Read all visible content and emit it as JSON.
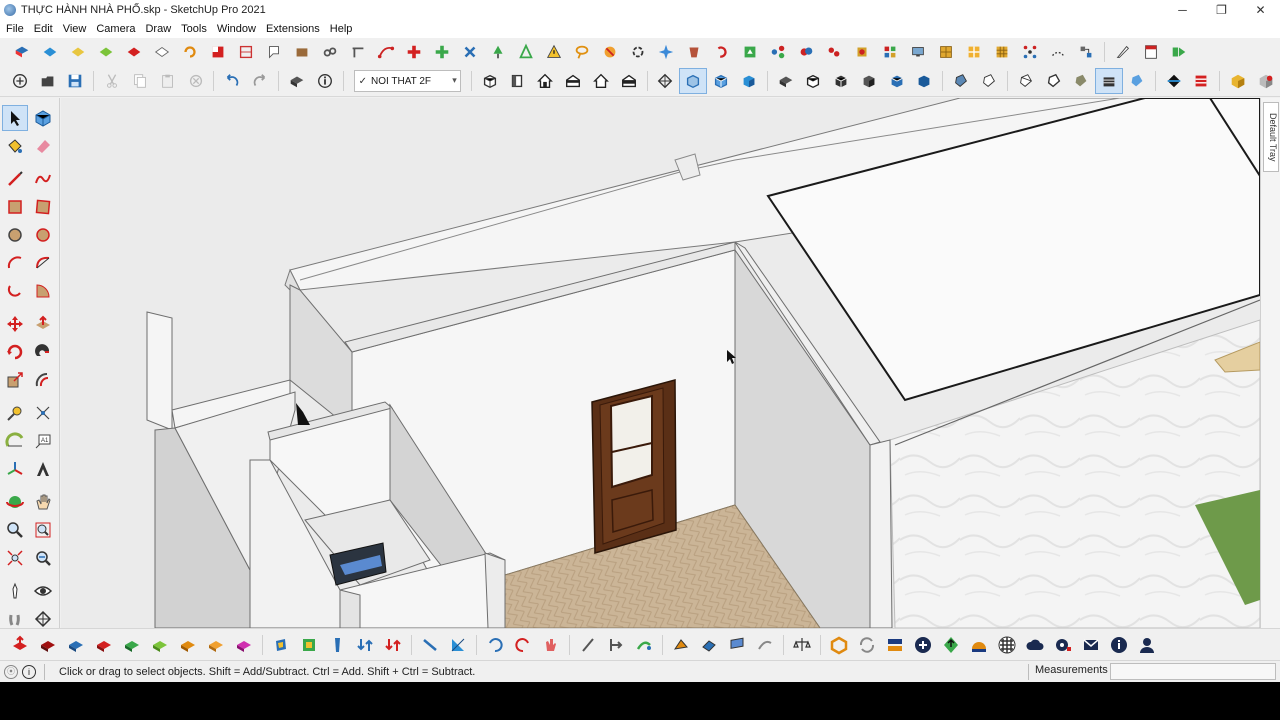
{
  "window": {
    "title": "THỰC HÀNH NHÀ PHỐ.skp - SketchUp Pro 2021",
    "minimize": "─",
    "restore": "❐",
    "close": "✕"
  },
  "menu": [
    "File",
    "Edit",
    "View",
    "Camera",
    "Draw",
    "Tools",
    "Window",
    "Extensions",
    "Help"
  ],
  "scene_dropdown": {
    "check": "✓",
    "value": "NOI THAT 2F"
  },
  "tray": {
    "label": "Default Tray"
  },
  "statusbar": {
    "info_icon": "i",
    "message": "Click or drag to select objects. Shift = Add/Subtract. Ctrl = Add. Shift + Ctrl = Subtract.",
    "measurements_label": "Measurements",
    "measurements_value": ""
  },
  "colors": {
    "accent_blue": "#2a6fb5",
    "red": "#d32020",
    "green": "#2e9b35",
    "viewport_bg": "#ebebeb",
    "door_wood": "#5a2f16",
    "floor_tile": "#cbb597"
  }
}
